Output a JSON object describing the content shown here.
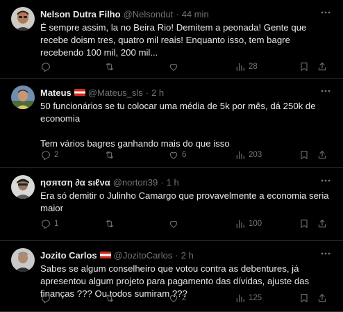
{
  "tweets": [
    {
      "name": "Nelson Dutra Filho",
      "handle": "@Nelsondut",
      "separator": "·",
      "time": "44 min",
      "has_flag": false,
      "text": "É sempre assim, la no Beira Rio! Demitem a peonada! Gente que recebe doism tres, quatro mil reais! Enquanto isso, tem bagre recebendo 100 mil, 200 mil...",
      "replies": "",
      "reposts": "",
      "likes": "",
      "views": "28"
    },
    {
      "name": "Mateus",
      "handle": "@Mateus_sls",
      "separator": "·",
      "time": "2 h",
      "has_flag": true,
      "text": "50 funcionários se tu colocar uma média de 5k por mês, dá 250k de economia\n\nTem vários bagres ganhando mais do que isso",
      "replies": "2",
      "reposts": "",
      "likes": "6",
      "views": "203"
    },
    {
      "name": "ησяτση ∂α ѕιℓνα",
      "handle": "@norton39",
      "separator": "·",
      "time": "1 h",
      "has_flag": false,
      "text": "Era só demitir o Julinho Camargo que provavelmente a economia seria maior",
      "replies": "1",
      "reposts": "",
      "likes": "",
      "views": "100"
    },
    {
      "name": "Jozito Carlos",
      "handle": "@JozitoCarlos",
      "separator": "·",
      "time": "2 h",
      "has_flag": true,
      "text": "Sabes se algum conselheiro que votou contra as debentures, já apresentou algum projeto para pagamento das dívidas, ajuste das finanças ??? Ou todos sumiram ???",
      "replies": "",
      "reposts": "",
      "likes": "2",
      "views": "125"
    }
  ],
  "icons": {
    "reply": "reply-icon",
    "repost": "repost-icon",
    "like": "like-icon",
    "views": "views-icon",
    "bookmark": "bookmark-icon",
    "share": "share-icon",
    "more": "more-icon"
  },
  "colors": {
    "background": "#000000",
    "text": "#e7e9ea",
    "muted": "#71767b",
    "divider": "#2f3336"
  }
}
